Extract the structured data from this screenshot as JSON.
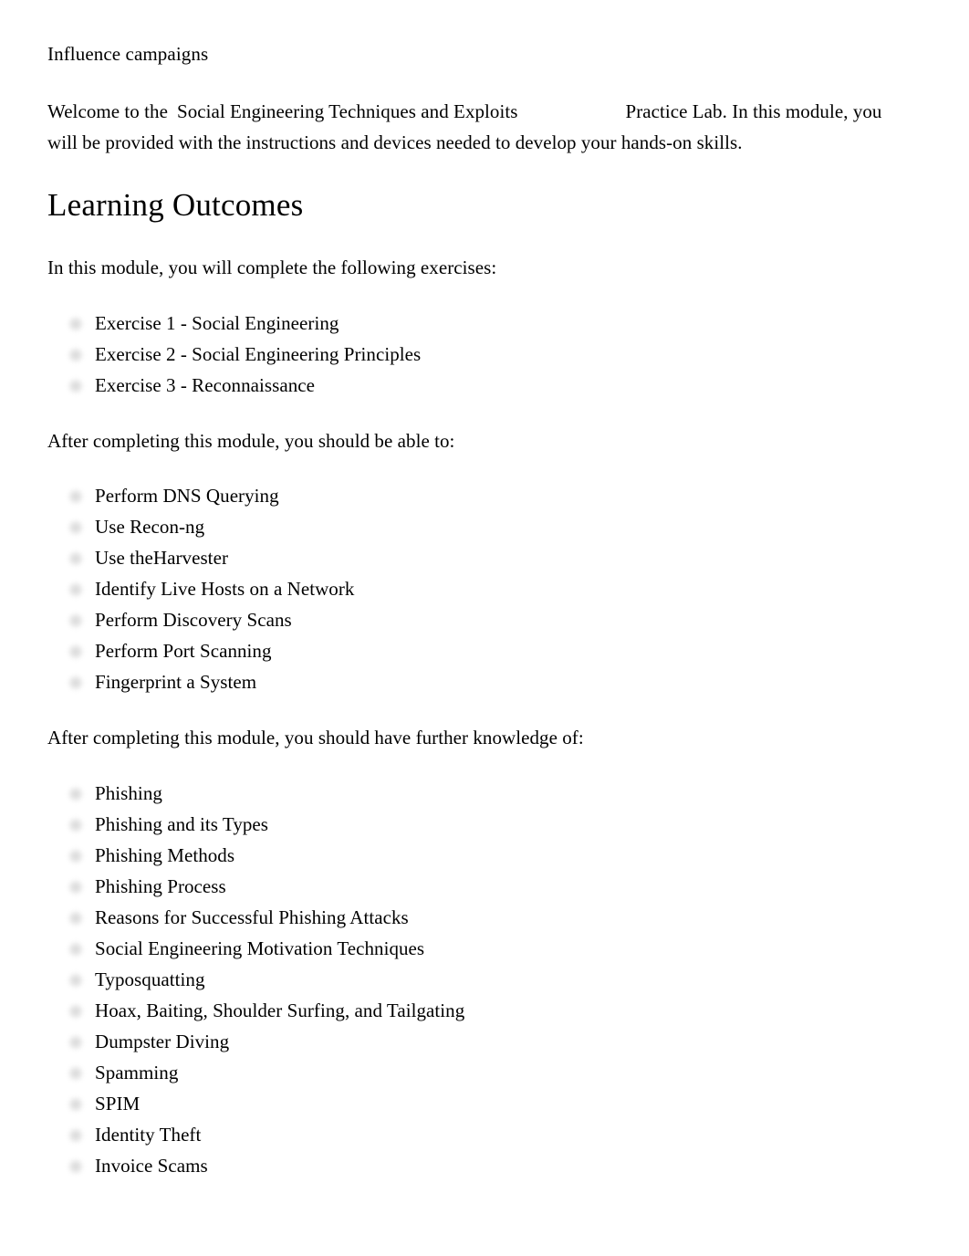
{
  "document": {
    "title": "Influence campaigns",
    "intro": {
      "before_lab_name": "Welcome to the",
      "lab_name": "Social Engineering Techniques and Exploits",
      "after_lab_name": "Practice Lab. In this module, you will be provided with the instructions and devices needed to develop your hands-on skills."
    },
    "sections": [
      {
        "heading": "Learning Outcomes",
        "exercises_intro": "In this module, you will complete the following exercises:",
        "exercises": [
          "Exercise 1 - Social Engineering",
          "Exercise 2 - Social Engineering Principles",
          "Exercise 3 - Reconnaissance"
        ],
        "objectives_intro": "After completing this module, you should be able to:",
        "objectives": [
          "Perform DNS Querying",
          "Use Recon-ng",
          "Use theHarvester",
          "Identify Live Hosts on a Network",
          "Perform Discovery Scans",
          "Perform Port Scanning",
          "Fingerprint a System"
        ],
        "knowledge_intro": "After completing this module, you should have further knowledge of:",
        "knowledge": [
          "Phishing",
          "Phishing and its Types",
          "Phishing Methods",
          "Phishing Process",
          "Reasons for Successful Phishing Attacks",
          "Social Engineering Motivation Techniques",
          "Typosquatting",
          "Hoax, Baiting, Shoulder Surfing, and Tailgating",
          "Dumpster Diving",
          "Spamming",
          "SPIM",
          "Identity Theft",
          "Invoice Scams"
        ]
      }
    ]
  },
  "style": {
    "background": "#ffffff",
    "text_color": "#000000",
    "bullet_marker_color": "#c9c9c9"
  }
}
